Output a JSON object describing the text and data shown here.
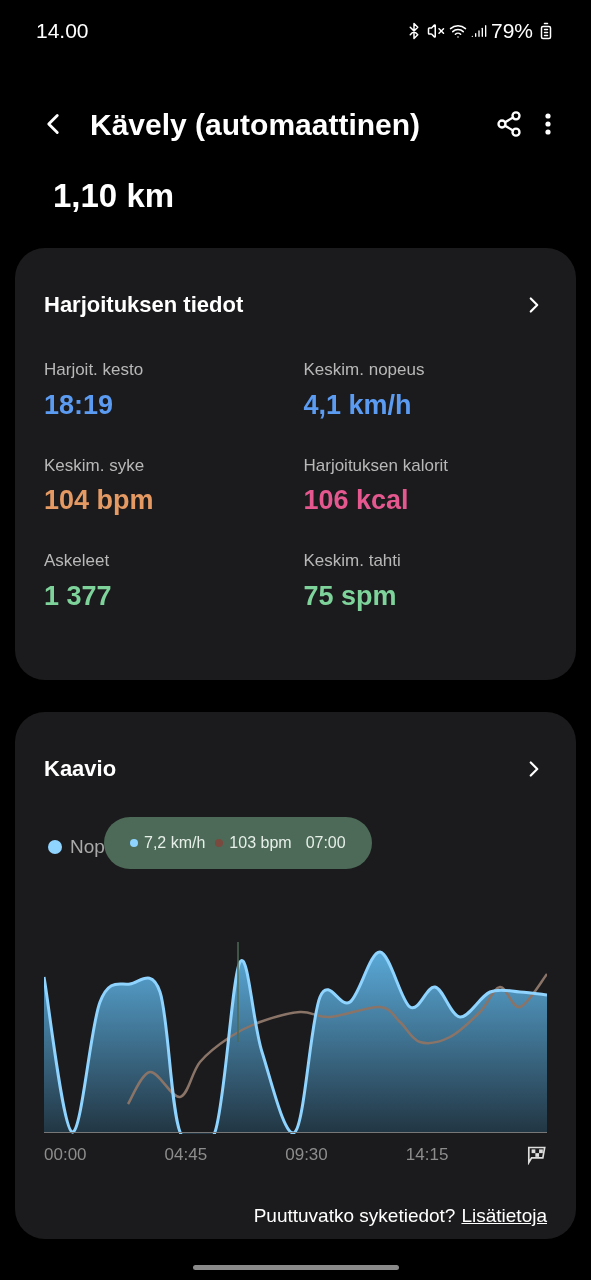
{
  "status_bar": {
    "time": "14.00",
    "battery": "79%"
  },
  "header": {
    "title": "Kävely (automaattinen)"
  },
  "distance": "1,10 km",
  "details": {
    "title": "Harjoituksen tiedot",
    "stats": [
      {
        "label": "Harjoit. kesto",
        "value": "18:19",
        "color": "#5b9cf2"
      },
      {
        "label": "Keskim. nopeus",
        "value": "4,1 km/h",
        "color": "#5b9cf2"
      },
      {
        "label": "Keskim. syke",
        "value": "104 bpm",
        "color": "#e59a63"
      },
      {
        "label": "Harjoituksen kalorit",
        "value": "106 kcal",
        "color": "#e4588f"
      },
      {
        "label": "Askeleet",
        "value": "1 377",
        "color": "#7ed39b"
      },
      {
        "label": "Keskim. tahti",
        "value": "75 spm",
        "color": "#7ed39b"
      }
    ]
  },
  "chart": {
    "title": "Kaavio",
    "legend": "Nop",
    "tooltip": {
      "speed": "7,2 km/h",
      "heart_rate": "103 bpm",
      "time": "07:00"
    },
    "x_labels": [
      "00:00",
      "04:45",
      "09:30",
      "14:15"
    ],
    "footer": "Puuttuvatko syketiedot?",
    "link": "Lisätietoja"
  }
}
